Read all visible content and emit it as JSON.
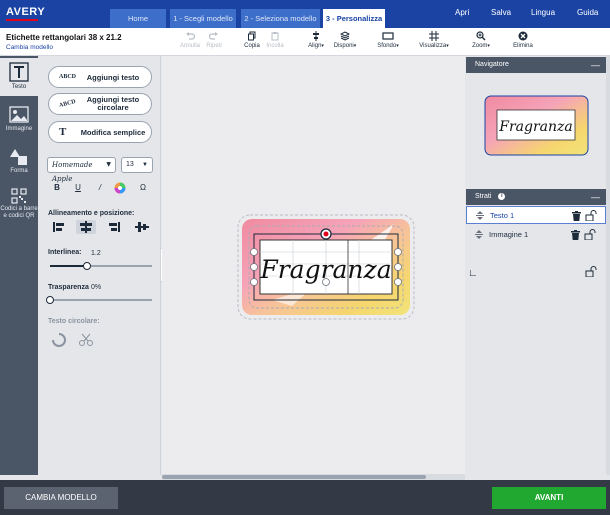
{
  "brand": {
    "logo": "AVERY",
    "accent": "#1a43a4",
    "logo_bar": "#e2001a"
  },
  "tabs": [
    {
      "label": "Home",
      "active": false
    },
    {
      "label": "1 - Scegli modello",
      "active": false
    },
    {
      "label": "2 - Seleziona modello",
      "active": false
    },
    {
      "label": "3 - Personalizza",
      "active": true
    }
  ],
  "topmenu": [
    "Apri",
    "Salva",
    "Lingua",
    "Guida"
  ],
  "document": {
    "title": "Etichette rettangolari 38 x 21.2",
    "change_link": "Cambia modello"
  },
  "toolbar": [
    {
      "label": "Annulla",
      "icon": "undo-icon",
      "enabled": false
    },
    {
      "label": "Ripeti",
      "icon": "redo-icon",
      "enabled": false
    },
    {
      "label": "Copia",
      "icon": "copy-icon",
      "enabled": true
    },
    {
      "label": "Incolla",
      "icon": "paste-icon",
      "enabled": false
    },
    {
      "label": "Align",
      "icon": "align-icon",
      "enabled": true
    },
    {
      "label": "Disponi",
      "icon": "layers-icon",
      "enabled": true
    },
    {
      "label": "Sfondo",
      "icon": "background-icon",
      "enabled": true
    },
    {
      "label": "Visualizza",
      "icon": "grid-icon",
      "enabled": true
    },
    {
      "label": "Zoom",
      "icon": "zoom-icon",
      "enabled": true
    },
    {
      "label": "Elimina",
      "icon": "delete-icon",
      "enabled": true
    }
  ],
  "rail": [
    {
      "label": "Testo",
      "icon": "text-icon",
      "active": true
    },
    {
      "label": "Immagine",
      "icon": "image-icon",
      "active": false
    },
    {
      "label": "Forma",
      "icon": "shape-icon",
      "active": false
    },
    {
      "label": "Codici a barre e codici QR",
      "icon": "qr-code-icon",
      "active": false
    }
  ],
  "panel": {
    "add_text": {
      "label": "Aggiungi testo",
      "icon_text": "ABCD"
    },
    "add_circular": {
      "label": "Aggiungi testo circolare",
      "icon_text": "ABCD"
    },
    "simple_edit": {
      "label": "Modifica semplice",
      "icon_text": "T"
    },
    "font": {
      "value": "Homemade Apple"
    },
    "font_size": {
      "value": "13"
    },
    "format": {
      "bold": "B",
      "underline": "U",
      "italic": "/",
      "symbol": "Ω"
    },
    "align_label": "Allineamento e posizione:",
    "line_spacing": {
      "label": "Interlinea:",
      "value": "1.2",
      "fraction": 0.36
    },
    "transparency": {
      "label": "Trasparenza",
      "value": "0%",
      "fraction": 0
    },
    "circular_label": "Testo circolare:"
  },
  "canvas": {
    "label_text": "Fragranza"
  },
  "navigator": {
    "title": "Navigatore",
    "preview_text": "Fragranza"
  },
  "layers": {
    "title": "Strati",
    "info_icon": "info-icon",
    "items": [
      {
        "name": "Testo 1",
        "active": true
      },
      {
        "name": "Immagine 1",
        "active": false
      }
    ]
  },
  "footer": {
    "change_model": "CAMBIA MODELLO",
    "next": "AVANTI"
  }
}
